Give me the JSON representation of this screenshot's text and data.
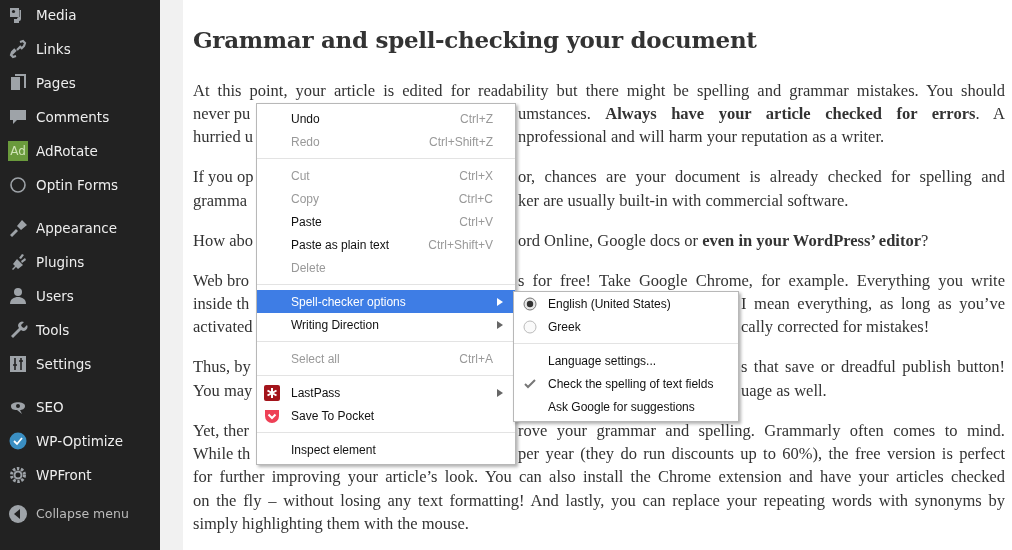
{
  "sidebar": {
    "groups": [
      [
        {
          "label": "Media"
        },
        {
          "label": "Links"
        },
        {
          "label": "Pages"
        },
        {
          "label": "Comments"
        },
        {
          "label": "AdRotate",
          "logo_text": "Ad"
        },
        {
          "label": "Optin Forms"
        }
      ],
      [
        {
          "label": "Appearance"
        },
        {
          "label": "Plugins"
        },
        {
          "label": "Users"
        },
        {
          "label": "Tools"
        },
        {
          "label": "Settings"
        }
      ],
      [
        {
          "label": "SEO"
        },
        {
          "label": "WP-Optimize"
        },
        {
          "label": "WPFront"
        }
      ]
    ],
    "collapse": "Collapse menu"
  },
  "article": {
    "heading": "Grammar and spell-checking your document",
    "paragraphs": [
      [
        {
          "text": "At this point, your article is edited for readability but there might be spelling and grammar mistakes. You should"
        },
        {
          "left": "never pu",
          "right": "umstances. **Always have your article checked for errors**. A"
        },
        {
          "left": "hurried u",
          "right": "nprofessional and will harm your reputation as a writer."
        }
      ],
      [
        {
          "left": "If you op",
          "right": "or, chances are your document is already checked for spelling and"
        },
        {
          "left": "gramma",
          "right": "ker are usually built-in with commercial software."
        }
      ],
      [
        {
          "left": "How abo",
          "right": "ord Online, Google docs or **even in your WordPress’ editor**?"
        }
      ],
      [
        {
          "left": "Web bro",
          "right": "s for free! Take Google Chrome, for example. Everything you write"
        },
        {
          "left": "inside th",
          "right": "I mean everything, as long as you’ve"
        },
        {
          "left": "activated",
          "right": "cally corrected for mistakes!"
        }
      ],
      [
        {
          "left": "Thus, by",
          "right": "s that save or dreadful publish button!"
        },
        {
          "left": "You may",
          "right": "uage as well."
        }
      ],
      [
        {
          "left": "Yet, ther",
          "right": "rove your grammar and spelling. Grammarly often comes to mind."
        },
        {
          "left": "While th",
          "right": "per year (they do run discounts up to 60%), the free version is perfect"
        },
        {
          "text": "for further improving your article’s look. You can also install the Chrome extension and have your articles checked"
        },
        {
          "text": "on the fly – without losing any text formatting! And lastly, you can replace your repeating words with synonyms by"
        },
        {
          "text": "simply highlighting them with the mouse."
        }
      ]
    ]
  },
  "context_menu": {
    "items": [
      {
        "kind": "item",
        "label": "Undo",
        "shortcut": "Ctrl+Z",
        "disabled": false,
        "selected": false
      },
      {
        "kind": "item",
        "label": "Redo",
        "shortcut": "Ctrl+Shift+Z",
        "disabled": true,
        "selected": false
      },
      {
        "kind": "separator"
      },
      {
        "kind": "item",
        "label": "Cut",
        "shortcut": "Ctrl+X",
        "disabled": true,
        "selected": false
      },
      {
        "kind": "item",
        "label": "Copy",
        "shortcut": "Ctrl+C",
        "disabled": true,
        "selected": false
      },
      {
        "kind": "item",
        "label": "Paste",
        "shortcut": "Ctrl+V",
        "disabled": false,
        "selected": false
      },
      {
        "kind": "item",
        "label": "Paste as plain text",
        "shortcut": "Ctrl+Shift+V",
        "disabled": false,
        "selected": false
      },
      {
        "kind": "item",
        "label": "Delete",
        "disabled": true,
        "selected": false
      },
      {
        "kind": "separator"
      },
      {
        "kind": "submenu",
        "label": "Spell-checker options",
        "disabled": false,
        "selected": true
      },
      {
        "kind": "submenu",
        "label": "Writing Direction",
        "disabled": false,
        "selected": false
      },
      {
        "kind": "separator"
      },
      {
        "kind": "item",
        "label": "Select all",
        "shortcut": "Ctrl+A",
        "disabled": true,
        "selected": false
      },
      {
        "kind": "separator"
      },
      {
        "kind": "extension-submenu",
        "label": "LastPass",
        "disabled": false,
        "selected": false
      },
      {
        "kind": "extension",
        "label": "Save To Pocket",
        "disabled": false,
        "selected": false
      },
      {
        "kind": "separator"
      },
      {
        "kind": "item",
        "label": "Inspect element",
        "disabled": false,
        "selected": false
      }
    ]
  },
  "submenu": {
    "items": [
      {
        "kind": "radio",
        "label": "English (United States)",
        "selected": true
      },
      {
        "kind": "radio",
        "label": "Greek",
        "selected": false
      },
      {
        "kind": "separator"
      },
      {
        "kind": "item",
        "label": "Language settings..."
      },
      {
        "kind": "check",
        "label": "Check the spelling of text fields",
        "checked": true
      },
      {
        "kind": "item",
        "label": "Ask Google for suggestions"
      }
    ]
  }
}
